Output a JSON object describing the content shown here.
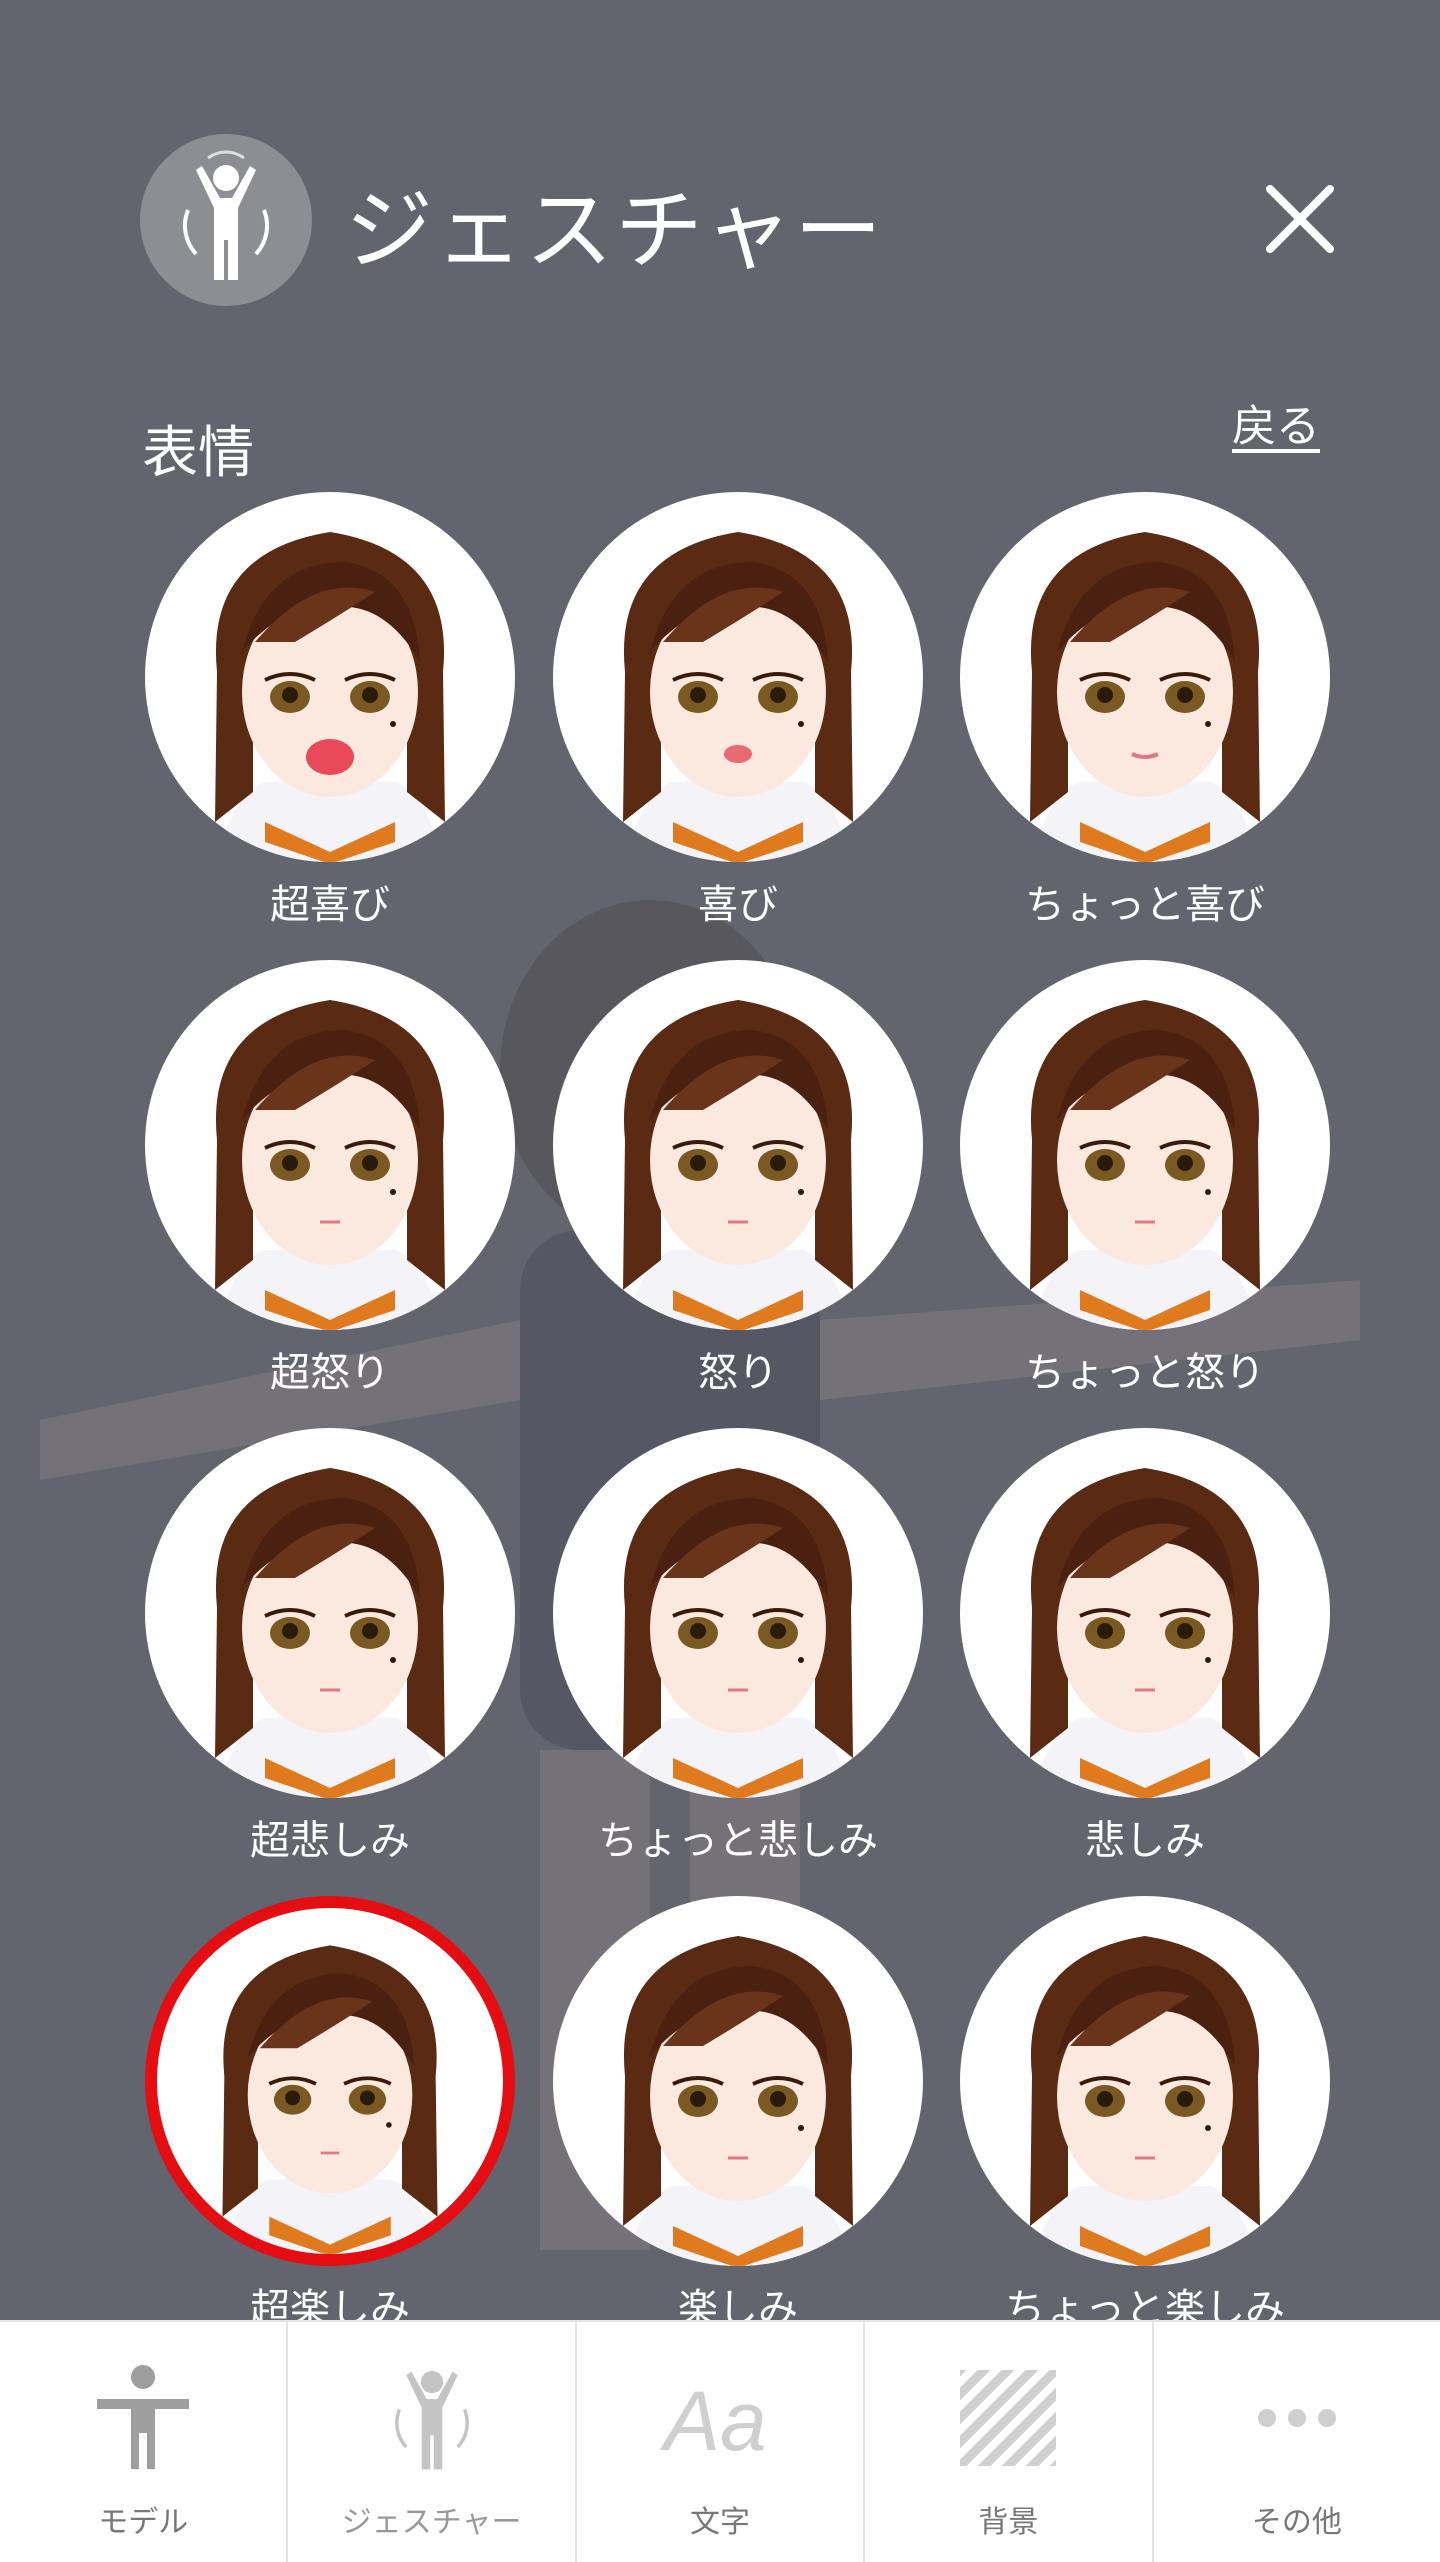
{
  "header": {
    "icon": "gesture-person-icon",
    "title": "ジェスチャー",
    "close_icon": "close-icon"
  },
  "section": {
    "title": "表情",
    "back_label": "戻る"
  },
  "expressions": [
    {
      "label": "超喜び",
      "selected": false
    },
    {
      "label": "喜び",
      "selected": false
    },
    {
      "label": "ちょっと喜び",
      "selected": false
    },
    {
      "label": "超怒り",
      "selected": false
    },
    {
      "label": "怒り",
      "selected": false
    },
    {
      "label": "ちょっと怒り",
      "selected": false
    },
    {
      "label": "超悲しみ",
      "selected": false
    },
    {
      "label": "ちょっと悲しみ",
      "selected": false
    },
    {
      "label": "悲しみ",
      "selected": false
    },
    {
      "label": "超楽しみ",
      "selected": true
    },
    {
      "label": "楽しみ",
      "selected": false
    },
    {
      "label": "ちょっと楽しみ",
      "selected": false
    }
  ],
  "tabbar": {
    "tabs": [
      {
        "label": "モデル",
        "icon": "person-icon"
      },
      {
        "label": "ジェスチャー",
        "icon": "gesture-icon"
      },
      {
        "label": "文字",
        "icon": "text-aa-icon"
      },
      {
        "label": "背景",
        "icon": "background-stripes-icon"
      },
      {
        "label": "その他",
        "icon": "more-dots-icon"
      }
    ]
  },
  "colors": {
    "overlay": "#62656e",
    "selected_ring": "#e30d12",
    "hair": "#5a2a12",
    "tab_icon": "#bdbdbd"
  }
}
